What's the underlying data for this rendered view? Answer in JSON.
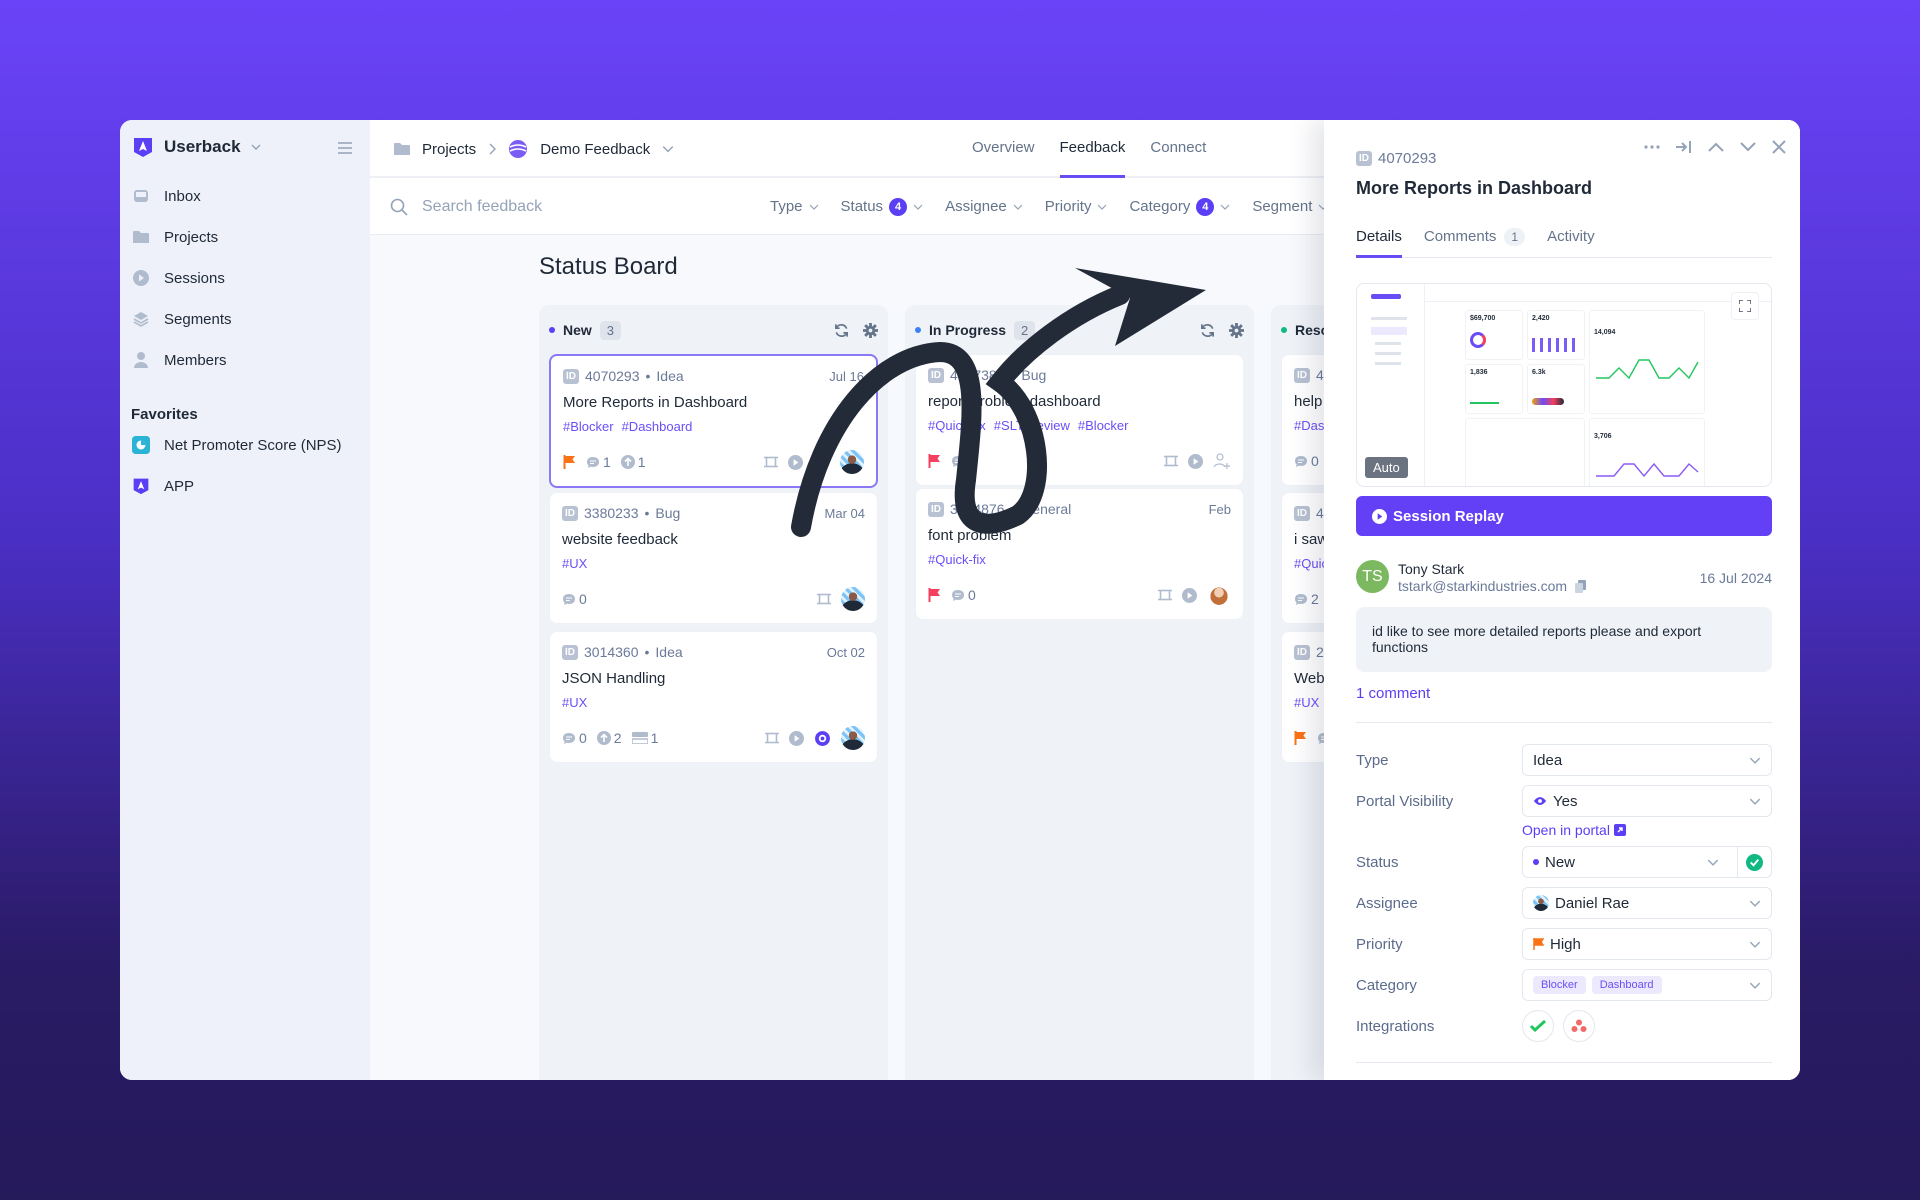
{
  "app": {
    "name": "Userback",
    "accent": "#5b3ff5"
  },
  "sidebar": {
    "items": [
      {
        "label": "Inbox",
        "icon": "inbox-icon"
      },
      {
        "label": "Projects",
        "icon": "folder-icon"
      },
      {
        "label": "Sessions",
        "icon": "play-circle-icon"
      },
      {
        "label": "Segments",
        "icon": "layers-icon"
      },
      {
        "label": "Members",
        "icon": "user-icon"
      }
    ],
    "favorites_title": "Favorites",
    "favorites": [
      {
        "label": "Net Promoter Score (NPS)",
        "icon": "nps-icon"
      },
      {
        "label": "APP",
        "icon": "userback-logo-icon"
      }
    ]
  },
  "header": {
    "breadcrumb": [
      "Projects",
      "Demo Feedback"
    ],
    "tabs": [
      {
        "label": "Overview",
        "active": false
      },
      {
        "label": "Feedback",
        "active": true
      },
      {
        "label": "Connect",
        "active": false
      }
    ]
  },
  "search": {
    "placeholder": "Search feedback",
    "value": ""
  },
  "filters": [
    {
      "label": "Type",
      "badge": null
    },
    {
      "label": "Status",
      "badge": "4"
    },
    {
      "label": "Assignee",
      "badge": null
    },
    {
      "label": "Priority",
      "badge": null
    },
    {
      "label": "Category",
      "badge": "4"
    },
    {
      "label": "Segment",
      "badge": null
    }
  ],
  "board": {
    "title": "Status Board",
    "columns": [
      {
        "name": "New",
        "count": "3",
        "dot": "#5b3ff5",
        "cards": [
          {
            "id": "4070293",
            "type": "Idea",
            "date": "Jul 16",
            "title": "More Reports in Dashboard",
            "tags": [
              "#Blocker",
              "#Dashboard"
            ],
            "flag": "#f97316",
            "comments": "1",
            "votes": "1",
            "attachments": null,
            "right": [
              "screenshot",
              "replay",
              "visible",
              "avatar"
            ],
            "selected": true
          },
          {
            "id": "3380233",
            "type": "Bug",
            "date": "Mar 04",
            "title": "website feedback",
            "tags": [
              "#UX"
            ],
            "flag": null,
            "comments": "0",
            "votes": null,
            "attachments": null,
            "right": [
              "screenshot",
              "avatar"
            ]
          },
          {
            "id": "3014360",
            "type": "Idea",
            "date": "Oct 02",
            "title": "JSON Handling",
            "tags": [
              "#UX"
            ],
            "flag": null,
            "comments": "0",
            "votes": "2",
            "attachments": "1",
            "right": [
              "screenshot",
              "replay",
              "visible",
              "avatar"
            ]
          }
        ]
      },
      {
        "name": "In Progress",
        "count": "2",
        "dot": "#3b82f6",
        "cards": [
          {
            "id": "4037381",
            "type": "Bug",
            "date": "",
            "title": "report problem dashboard",
            "tags": [
              "#Quick-fix",
              "#SLT Review",
              "#Blocker"
            ],
            "flag": "#f43f5e",
            "comments": "1",
            "votes": null,
            "attachments": null,
            "right": [
              "screenshot",
              "replay",
              "add-assignee"
            ]
          },
          {
            "id": "3334876",
            "type": "General",
            "date": "Feb",
            "title": "font problem",
            "tags": [
              "#Quick-fix"
            ],
            "flag": "#f43f5e",
            "comments": "0",
            "votes": null,
            "attachments": null,
            "right": [
              "screenshot",
              "replay",
              "avatar-w"
            ]
          }
        ]
      },
      {
        "name": "Resolved",
        "count": "",
        "dot": "#10b981",
        "cards": [
          {
            "id": "4450205",
            "type": "General",
            "date": "",
            "title": "help me???",
            "tags": [
              "#Dashboard"
            ],
            "flag": null,
            "comments": "0",
            "votes": null,
            "attachments": null,
            "right": []
          },
          {
            "id": "4070283",
            "type": "Bug",
            "date": "",
            "title": "i saw an error",
            "tags": [
              "#Quick-fix"
            ],
            "flag": null,
            "comments": "2",
            "votes": null,
            "attachments": null,
            "right": []
          },
          {
            "id": "2791770",
            "type": "General",
            "date": "",
            "title": "Webtest",
            "tags": [
              "#UX"
            ],
            "flag": "#f97316",
            "comments": "2",
            "votes": null,
            "attachments": null,
            "right": []
          }
        ]
      }
    ]
  },
  "panel": {
    "id": "4070293",
    "title": "More Reports in Dashboard",
    "tabs": [
      {
        "label": "Details"
      },
      {
        "label": "Comments",
        "count": "1"
      },
      {
        "label": "Activity"
      }
    ],
    "preview": {
      "badge": "Auto",
      "stats": [
        "$69,700",
        "2,420",
        "14,094",
        "1,836",
        "6.3k",
        "3,706"
      ]
    },
    "session_replay_label": "Session Replay",
    "user": {
      "initials": "TS",
      "name": "Tony Stark",
      "email": "tstark@starkindustries.com",
      "date": "16 Jul 2024"
    },
    "message": "id like to see more detailed reports please and export functions",
    "comments_link": "1 comment",
    "fields": {
      "type": {
        "label": "Type",
        "value": "Idea"
      },
      "portal": {
        "label": "Portal Visibility",
        "value": "Yes",
        "link": "Open in portal"
      },
      "status": {
        "label": "Status",
        "value": "New"
      },
      "assignee": {
        "label": "Assignee",
        "value": "Daniel Rae"
      },
      "priority": {
        "label": "Priority",
        "value": "High"
      },
      "category": {
        "label": "Category",
        "values": [
          "Blocker",
          "Dashboard"
        ]
      },
      "integrations": {
        "label": "Integrations",
        "items": [
          "check-integration-icon",
          "asana-icon"
        ]
      }
    }
  }
}
